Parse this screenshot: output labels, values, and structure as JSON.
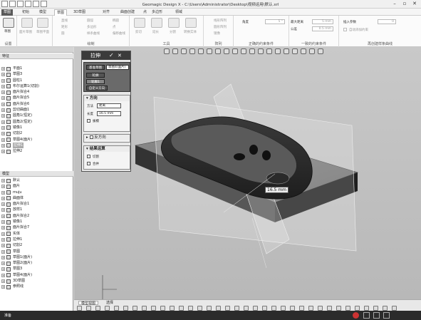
{
  "window": {
    "title": "Geomagic Design X - C:\\Users\\Administrator\\Desktop\\视频运用\\默认.xrl"
  },
  "menu": {
    "tabs": [
      "草图",
      "初始",
      "模型",
      "草图",
      "3D草图",
      "对齐",
      "曲面创建",
      "点",
      "多边形",
      "领域"
    ]
  },
  "ribbon": {
    "groups": [
      "设置",
      "绘制",
      "工具",
      "阵列",
      "正确的约束条件",
      "一致的约束条件",
      "再创建样条曲线"
    ],
    "buttons": {
      "exit": "草图",
      "set1": "面片草图",
      "set2": "草图平面",
      "draw": [
        "直线",
        "矩形",
        "圆",
        "圆弧",
        "多边形",
        "样条曲线",
        "椭圆",
        "点",
        "偏移曲线",
        "投影"
      ],
      "tools": [
        "剪切",
        "延长",
        "分割",
        "要素变换",
        "转换实体"
      ],
      "pattern": [
        "线形阵列",
        "圆形阵列",
        "镜像"
      ]
    },
    "constraints": {
      "angle_label": "角度",
      "angle_value": "5 °",
      "dist_label": "最大距离",
      "dist_value": "5 mm",
      "weight_label": "公差",
      "weight_value": "0.5 mm",
      "insert_label": "插入参数",
      "insert_value": "0",
      "fit_label": "自动添加约束"
    }
  },
  "left_panel": {
    "feature_header": "特征",
    "feature_items": [
      "平面1",
      "草图3",
      "圆柱1",
      "布尔运算1(切割)",
      "面片拟合4",
      "面片拟合5",
      "面片拟合6",
      "剪切曲面1",
      "圆角1(恒定)",
      "圆角2(恒定)",
      "镜像1",
      "切割2",
      "草图4(面片)",
      "拉伸1",
      "拉伸2"
    ],
    "model_header": "模型",
    "model_items": [
      "默认",
      "面片",
      "muju",
      "曲面体",
      "面片拟合1",
      "放样1",
      "面片拟合2",
      "镜像1",
      "面片拟合7",
      "实体",
      "拉伸1",
      "切割2",
      "草图",
      "草图1(面片)",
      "草图2(面片)",
      "草图3",
      "草图4(面片)",
      "3D草图",
      "参照线"
    ]
  },
  "dialog": {
    "title": "拉伸",
    "ok": "✓",
    "cancel": "✕",
    "base_sketch": "基准草图",
    "base_value": "草图4(面片)",
    "contour": "轮廓",
    "contour_value": "轮廓1",
    "custom_dir": "自定义方向",
    "direction_header": "方向",
    "method_label": "方法",
    "method_value": "距离",
    "length_label": "长度",
    "length_value": "16.5 mm",
    "draft": "拔模",
    "reverse_header": "反方向",
    "result_header": "结果运算",
    "cut": "切割",
    "merge": "合并"
  },
  "viewport": {
    "dimension_label": "16.5 mm"
  },
  "bottom": {
    "tabs": [
      "模型视图",
      "选择"
    ]
  },
  "status": {
    "text": "准备"
  }
}
